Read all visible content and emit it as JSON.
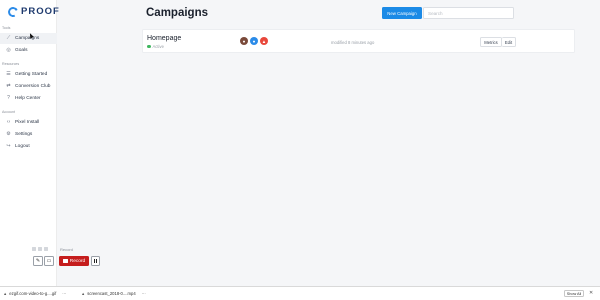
{
  "brand": {
    "logo_text": "PROOF"
  },
  "sidebar": {
    "sections": [
      {
        "label": "Tools"
      },
      {
        "label": "Resources"
      },
      {
        "label": "Account"
      }
    ],
    "items": [
      {
        "label": "Campaigns",
        "icon": "wand-icon"
      },
      {
        "label": "Goals",
        "icon": "target-icon"
      },
      {
        "label": "Getting Started",
        "icon": "list-icon"
      },
      {
        "label": "Conversion Club",
        "icon": "sync-icon"
      },
      {
        "label": "Help Center",
        "icon": "help-icon"
      },
      {
        "label": "Pixel Install",
        "icon": "code-icon"
      },
      {
        "label": "Settings",
        "icon": "gear-icon"
      },
      {
        "label": "Logout",
        "icon": "logout-icon"
      }
    ]
  },
  "header": {
    "title": "Campaigns",
    "new_campaign_label": "New Campaign",
    "search_placeholder": "Search"
  },
  "campaign": {
    "name": "Homepage",
    "status": "Active",
    "modified": "modified 8 minutes ago",
    "metrics_label": "Metrics",
    "edit_label": "Edit",
    "status_color": "#3fb65f"
  },
  "recorder": {
    "label": "Record",
    "record_label": "Record"
  },
  "downloads": {
    "items": [
      {
        "name": "ezgif.com-video-to-g....gif"
      },
      {
        "name": "screencast_2018-0....mp4"
      }
    ],
    "show_all_label": "Show All",
    "close_glyph": "✕",
    "more_glyph": "⋯"
  },
  "colors": {
    "accent": "#1b8ae6",
    "record": "#c51d1d"
  }
}
